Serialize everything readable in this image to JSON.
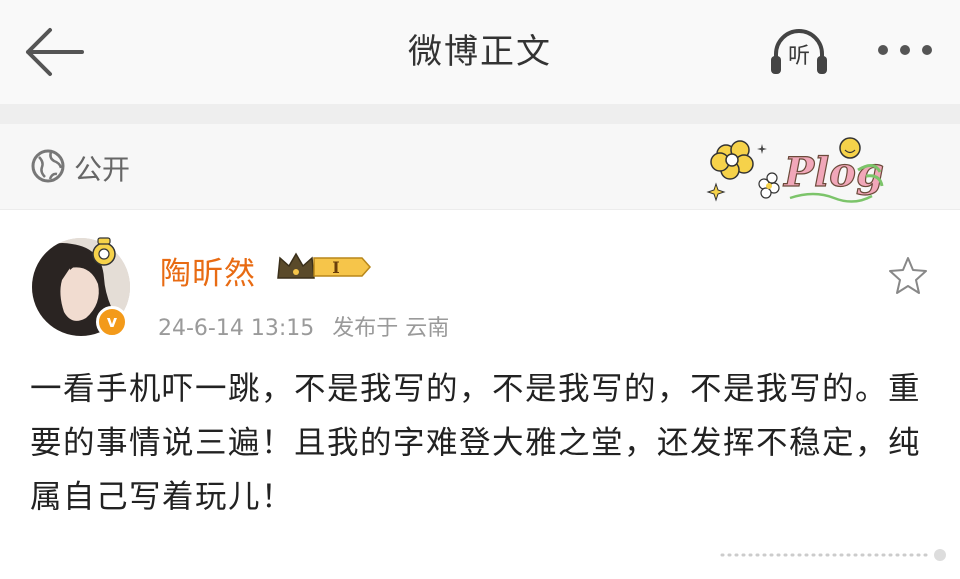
{
  "header": {
    "title": "微博正文",
    "listen_label": "听"
  },
  "visibility": {
    "label": "公开"
  },
  "post": {
    "author": "陶昕然",
    "rank_badge": "I",
    "timestamp": "24-6-14 13:15",
    "location": "发布于 云南",
    "text": "一看手机吓一跳，不是我写的，不是我写的，不是我写的。重要的事情说三遍！且我的字难登大雅之堂，还发挥不稳定，纯属自己写着玩儿！",
    "sticker_text": "Plog"
  },
  "colors": {
    "username": "#e86b13",
    "verified_badge": "#f39a1a",
    "header_bg": "#f9f9f9",
    "meta_text": "#9a9a9a"
  },
  "icons": [
    "back-arrow-icon",
    "headphones-icon",
    "more-icon",
    "globe-icon",
    "star-icon",
    "crown-icon",
    "verified-icon"
  ]
}
